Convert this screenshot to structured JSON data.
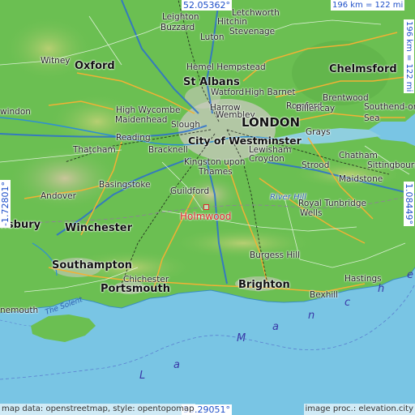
{
  "map": {
    "coords": {
      "top": "52.05362°",
      "bottom": "50.29051°",
      "left": "-1.72801°",
      "right": "1.08449°",
      "scale_top": "196 km = 122 mi",
      "scale_right": "196 km = 122 mi"
    },
    "focus_place": "Holmwood",
    "places": {
      "leighton_buzzard_1": "Leighton",
      "leighton_buzzard_2": "Buzzard",
      "letchworth": "Letchworth",
      "hitchin": "Hitchin",
      "stevenage": "Stevenage",
      "luton": "Luton",
      "witney": "Witney",
      "oxford": "Oxford",
      "hemel": "Hemel Hempstead",
      "st_albans": "St Albans",
      "watford": "Watford",
      "high_barnet": "High Barnet",
      "chelmsford": "Chelmsford",
      "high_wycombe": "High Wycombe",
      "maidenhead": "Maidenhead",
      "harrow": "Harrow",
      "wembley": "Wembley",
      "romford": "Romford",
      "brentwood": "Brentwood",
      "billericay": "Billericay",
      "southend": "Southend-on-",
      "southend_2": "Sea",
      "swindon": "windon",
      "slough": "Slough",
      "london": "LONDON",
      "reading": "Reading",
      "grays": "Grays",
      "thatcham": "Thatcham",
      "bracknell": "Bracknell",
      "city_westminster": "City of Westminster",
      "lewisham": "Lewisham",
      "chatham": "Chatham",
      "sittingbourne": "Sittingbourne",
      "kingston": "Kingston upon",
      "thames": "Thames",
      "croydon": "Croydon",
      "basingstoke": "Basingstoke",
      "strood": "Strood",
      "maidstone": "Maidstone",
      "andover": "Andover",
      "guildford": "Guildford",
      "river_hill": "River Hill",
      "royal_tunbridge": "Royal Tunbridge",
      "wells": "Wells",
      "salisbury": "lisbury",
      "winchester": "Winchester",
      "burgess_hill": "Burgess Hill",
      "southampton": "Southampton",
      "chichester": "Chichester",
      "portsmouth": "Portsmouth",
      "hastings": "Hastings",
      "brighton": "Brighton",
      "bexhill": "Bexhill",
      "bournemouth": "nemouth",
      "solent": "The Solent",
      "sea_letters": [
        "L",
        "a",
        "M",
        "a",
        "n",
        "c",
        "h",
        "e"
      ]
    },
    "footer": {
      "left": "map data: openstreetmap, style: opentopomap",
      "right": "image proc.: elevation.city"
    }
  }
}
